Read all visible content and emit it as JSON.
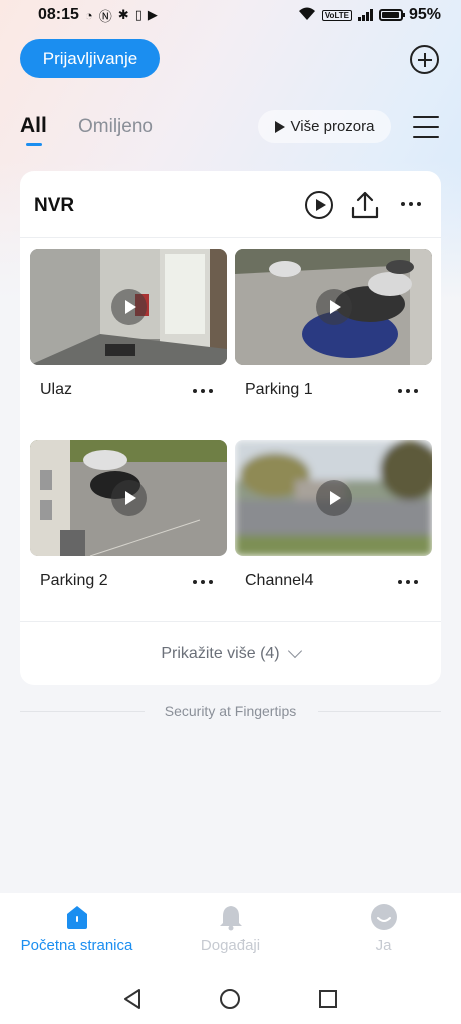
{
  "status_bar": {
    "time": "08:15",
    "battery": "95%",
    "volte": "VoLTE"
  },
  "header": {
    "login_label": "Prijavljivanje",
    "add_icon": "plus-circle-icon"
  },
  "tabs": {
    "all": "All",
    "favorites": "Omiljeno",
    "multi_window": "Više prozora"
  },
  "nvr": {
    "title": "NVR",
    "cameras": [
      {
        "name": "Ulaz"
      },
      {
        "name": "Parking 1"
      },
      {
        "name": "Parking 2"
      },
      {
        "name": "Channel4"
      }
    ],
    "show_more": "Prikažite više (4)"
  },
  "footer": {
    "tagline": "Security at Fingertips"
  },
  "bottom_nav": {
    "home": "Početna stranica",
    "events": "Događaji",
    "me": "Ja"
  },
  "colors": {
    "accent": "#1b8ef0",
    "inactive": "#c6cad1"
  }
}
